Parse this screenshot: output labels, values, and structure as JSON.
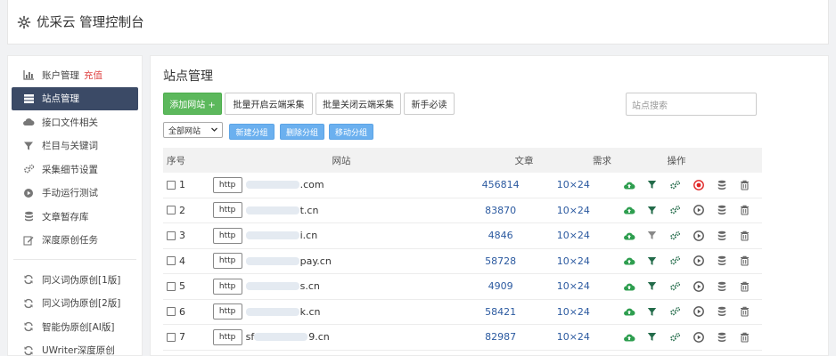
{
  "header": {
    "title": "优采云 管理控制台"
  },
  "sidebar": {
    "items": [
      {
        "label": "账户管理",
        "badge": "充值",
        "icon": "bar-chart-icon"
      },
      {
        "label": "站点管理",
        "icon": "list-icon",
        "active": true
      },
      {
        "label": "接口文件相关",
        "icon": "cloud-icon"
      },
      {
        "label": "栏目与关键词",
        "icon": "filter-icon"
      },
      {
        "label": "采集细节设置",
        "icon": "gears-icon"
      },
      {
        "label": "手动运行测试",
        "icon": "play-icon"
      },
      {
        "label": "文章暂存库",
        "icon": "database-icon"
      },
      {
        "label": "深度原创任务",
        "icon": "edit-icon"
      }
    ],
    "items2": [
      {
        "label": "同义词伪原创[1版]",
        "icon": "refresh-icon"
      },
      {
        "label": "同义词伪原创[2版]",
        "icon": "refresh-icon"
      },
      {
        "label": "智能伪原创[AI版]",
        "icon": "refresh-icon"
      },
      {
        "label": "UWriter深度原创",
        "icon": "refresh-icon"
      }
    ]
  },
  "main": {
    "title": "站点管理",
    "toolbar": {
      "add_label": "添加网站 +",
      "batch_open_label": "批量开启云端采集",
      "batch_close_label": "批量关闭云端采集",
      "guide_label": "新手必读"
    },
    "search_placeholder": "站点搜索",
    "filter": {
      "selected": "全部网站"
    },
    "group_buttons": {
      "new": "新建分组",
      "delete": "删除分组",
      "move": "移动分组"
    },
    "table": {
      "headers": {
        "no": "序号",
        "site": "网站",
        "articles": "文章",
        "demand": "需求",
        "ops": "操作"
      },
      "protocol": "http",
      "rows": [
        {
          "no": "1",
          "domain": ".com",
          "articles": "456814",
          "demand": "10×24",
          "filter_active": true,
          "running": true
        },
        {
          "no": "2",
          "domain": "t.cn",
          "articles": "83870",
          "demand": "10×24",
          "filter_active": true,
          "running": false
        },
        {
          "no": "3",
          "domain": "i.cn",
          "articles": "4846",
          "demand": "10×24",
          "filter_active": false,
          "running": false
        },
        {
          "no": "4",
          "domain": "pay.cn",
          "articles": "58728",
          "demand": "10×24",
          "filter_active": true,
          "running": false
        },
        {
          "no": "5",
          "domain": "s.cn",
          "articles": "4909",
          "demand": "10×24",
          "filter_active": true,
          "running": false
        },
        {
          "no": "6",
          "domain": "k.cn",
          "articles": "58421",
          "demand": "10×24",
          "filter_active": true,
          "running": false
        },
        {
          "no": "7",
          "domain": "9.cn",
          "prefix": "sf",
          "articles": "82987",
          "demand": "10×24",
          "filter_active": true,
          "running": false
        }
      ]
    }
  },
  "colors": {
    "active_nav": "#3b4a66",
    "green": "#5cb85c",
    "blue": "#6bb0ef",
    "link": "#2c5aa0",
    "running": "#e02424",
    "cloud": "#2e9e4f"
  }
}
